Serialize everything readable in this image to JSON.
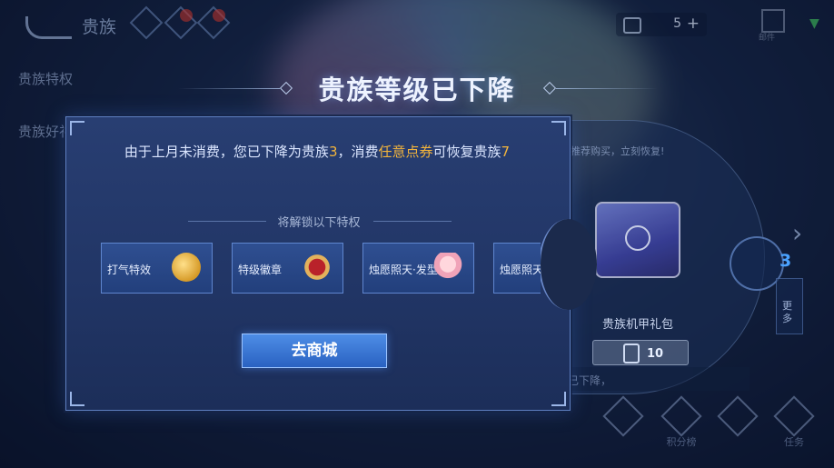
{
  "topbar": {
    "title": "贵族",
    "currency_value": "5",
    "currency_plus": "+",
    "mail_label": "邮件"
  },
  "side_menu": {
    "items": [
      "贵族特权",
      "贵族好礼"
    ]
  },
  "banner": {
    "title": "贵族等级已下降"
  },
  "background_panel": {
    "recommend_text": "推荐购买，立刻恢复!",
    "gift_label": "贵族机甲礼包",
    "price": "10",
    "restore_text": "已下降，",
    "level_text": "3",
    "more_label": "更多",
    "bottom_nav": [
      "",
      "积分榜",
      "",
      "任务"
    ]
  },
  "modal": {
    "message_parts": [
      "由于上月未消费，您已下降为贵族",
      "3",
      "，消费",
      "任意点券",
      "可恢复贵族",
      "7"
    ],
    "unlock_title": "将解锁以下特权",
    "privileges": [
      {
        "label": "打气特效",
        "icon": "fist-icon"
      },
      {
        "label": "特级徽章",
        "icon": "badge-icon"
      },
      {
        "label": "烛愿照天·发型",
        "icon": "hairstyle-icon"
      },
      {
        "label": "烛愿照天",
        "icon": "hairstyle-icon"
      }
    ],
    "shop_button": "去商城"
  },
  "colors": {
    "highlight": "#f3b53c",
    "button": "#3a74d4",
    "panel": "#243a6c"
  }
}
